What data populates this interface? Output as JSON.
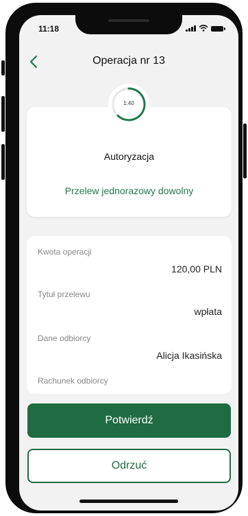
{
  "status_bar": {
    "time": "11:18"
  },
  "header": {
    "back_icon": "chevron-left-icon",
    "title": "Operacja nr 13"
  },
  "authorization": {
    "timer": "1:40",
    "title": "Autoryzacja",
    "operation_type": "Przelew jednorazowy dowolny"
  },
  "details": [
    {
      "label": "Kwota operacji",
      "value": "120,00 PLN"
    },
    {
      "label": "Tytuł przelewu",
      "value": "wpłata"
    },
    {
      "label": "Dane odbiorcy",
      "value": "Alicja Ikasińska"
    },
    {
      "label": "Rachunek odbiorcy",
      "value": ""
    }
  ],
  "actions": {
    "confirm_label": "Potwierdź",
    "reject_label": "Odrzuć"
  },
  "colors": {
    "accent": "#1f6b43",
    "accent_text": "#1f7a4c",
    "background": "#f2f2f2"
  }
}
